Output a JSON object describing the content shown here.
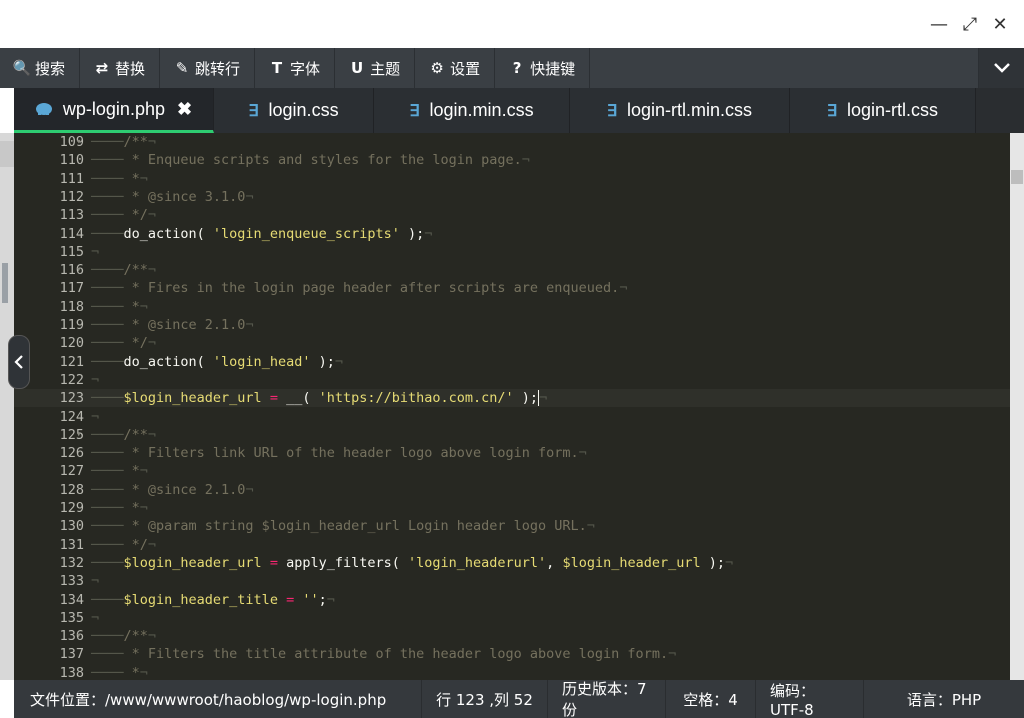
{
  "window": {
    "minimize_glyph": "—",
    "maximize_glyph": "⤢",
    "close_glyph": "✕"
  },
  "toolbar": {
    "items": [
      {
        "icon": "search-icon",
        "glyph": "🔍",
        "label": "搜索"
      },
      {
        "icon": "replace-icon",
        "glyph": "⇄",
        "label": "替换"
      },
      {
        "icon": "pin-icon",
        "glyph": "✎",
        "label": "跳转行"
      },
      {
        "icon": "font-icon",
        "glyph": "T",
        "label": "字体"
      },
      {
        "icon": "theme-icon",
        "glyph": "U",
        "label": "主题"
      },
      {
        "icon": "gear-icon",
        "glyph": "⚙",
        "label": "设置"
      },
      {
        "icon": "help-icon",
        "glyph": "?",
        "label": "快捷键"
      }
    ],
    "collapse_glyph": "⌄"
  },
  "tabs": [
    {
      "label": "wp-login.php",
      "icon": "php-elephant-icon",
      "active": true,
      "close": "✖"
    },
    {
      "label": "login.css",
      "icon": "css3-icon",
      "active": false
    },
    {
      "label": "login.min.css",
      "icon": "css3-icon",
      "active": false
    },
    {
      "label": "login-rtl.min.css",
      "icon": "css3-icon",
      "active": false
    },
    {
      "label": "login-rtl.css",
      "icon": "css3-icon",
      "active": false
    }
  ],
  "editor": {
    "current_line": 123,
    "lines": [
      {
        "n": "109",
        "fold": true,
        "t": "c",
        "text": "/**"
      },
      {
        "n": "110",
        "t": "c",
        "text": " * Enqueue scripts and styles for the login page."
      },
      {
        "n": "111",
        "t": "c",
        "text": " *"
      },
      {
        "n": "112",
        "t": "c",
        "text": " * @since 3.1.0"
      },
      {
        "n": "113",
        "t": "c",
        "text": " */"
      },
      {
        "n": "114",
        "t": "call",
        "fn": "do_action( ",
        "str": "'login_enqueue_scripts'",
        "end": " );"
      },
      {
        "n": "115",
        "t": "e"
      },
      {
        "n": "116",
        "fold": true,
        "t": "c",
        "text": "/**"
      },
      {
        "n": "117",
        "t": "c",
        "text": " * Fires in the login page header after scripts are enqueued."
      },
      {
        "n": "118",
        "t": "c",
        "text": " *"
      },
      {
        "n": "119",
        "t": "c",
        "text": " * @since 2.1.0"
      },
      {
        "n": "120",
        "t": "c",
        "text": " */"
      },
      {
        "n": "121",
        "t": "call",
        "fn": "do_action( ",
        "str": "'login_head'",
        "end": " );"
      },
      {
        "n": "122",
        "t": "e"
      },
      {
        "n": "123",
        "t": "assign",
        "var": "$login_header_url",
        "op": " = ",
        "fn": "__( ",
        "str": "'https://bithao.com.cn/'",
        "end": " );"
      },
      {
        "n": "124",
        "t": "e"
      },
      {
        "n": "125",
        "fold": true,
        "t": "c",
        "text": "/**"
      },
      {
        "n": "126",
        "t": "c",
        "text": " * Filters link URL of the header logo above login form."
      },
      {
        "n": "127",
        "t": "c",
        "text": " *"
      },
      {
        "n": "128",
        "t": "c",
        "text": " * @since 2.1.0"
      },
      {
        "n": "129",
        "t": "c",
        "text": " *"
      },
      {
        "n": "130",
        "t": "c",
        "text": " * @param string $login_header_url Login header logo URL."
      },
      {
        "n": "131",
        "t": "c",
        "text": " */"
      },
      {
        "n": "132",
        "t": "assign",
        "var": "$login_header_url",
        "op": " = ",
        "fn": "apply_filters( ",
        "str": "'login_headerurl'",
        "mid": ", ",
        "var2": "$login_header_url",
        "end": " );"
      },
      {
        "n": "133",
        "t": "e"
      },
      {
        "n": "134",
        "t": "assign",
        "var": "$login_header_title",
        "op": " = ",
        "fn": "",
        "str": "''",
        "end": ";"
      },
      {
        "n": "135",
        "t": "e"
      },
      {
        "n": "136",
        "fold": true,
        "t": "c",
        "text": "/**"
      },
      {
        "n": "137",
        "t": "c",
        "text": " * Filters the title attribute of the header logo above login form."
      },
      {
        "n": "138",
        "t": "c",
        "text": " *"
      }
    ]
  },
  "status": {
    "path": "文件位置：/www/wwwroot/haoblog/wp-login.php",
    "position": "行 123 ,列 52",
    "history": "历史版本：7份",
    "indent": "空格：4",
    "encoding": "编码：UTF-8",
    "language": "语言：PHP"
  },
  "colors": {
    "editor_bg": "#272822",
    "comment": "#75715e",
    "string": "#e6db74",
    "operator": "#f92672",
    "active_tab_underline": "#2ecc71"
  }
}
